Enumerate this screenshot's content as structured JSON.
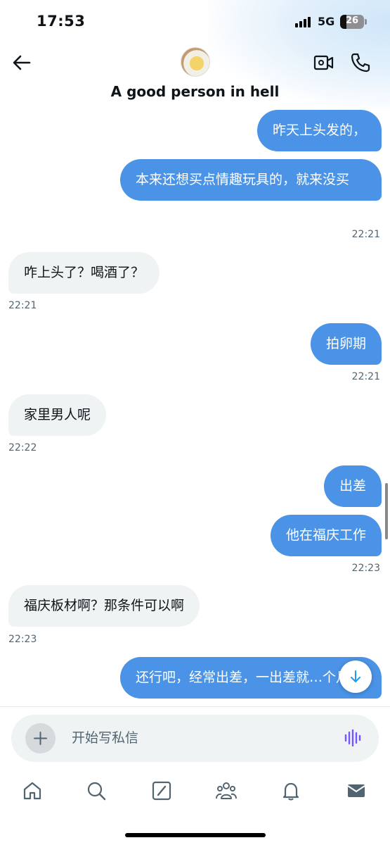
{
  "status_bar": {
    "time": "17:53",
    "network": "5G",
    "battery": "26"
  },
  "header": {
    "title": "A good person in hell"
  },
  "messages": [
    {
      "side": "out",
      "text": "昨天上头发的，"
    },
    {
      "side": "out",
      "text": "本来还想买点情趣玩具的，就来没买",
      "time": "22:21"
    },
    {
      "side": "in",
      "text": "咋上头了？喝酒了？",
      "time": "22:21"
    },
    {
      "side": "out",
      "text": "拍卵期",
      "time": "22:21"
    },
    {
      "side": "in",
      "text": "家里男人呢",
      "time": "22:22"
    },
    {
      "side": "out",
      "text": "出差"
    },
    {
      "side": "out",
      "text": "他在福庆工作",
      "time": "22:23"
    },
    {
      "side": "in",
      "text": "福庆板材啊？那条件可以啊",
      "time": "22:23"
    },
    {
      "side": "out",
      "text": "还行吧，经常出差，一出差就…个月"
    }
  ],
  "composer": {
    "placeholder": "开始写私信"
  },
  "nav": {
    "items": [
      "home-icon",
      "search-icon",
      "grok-icon",
      "communities-icon",
      "notifications-icon",
      "messages-icon"
    ]
  },
  "colors": {
    "outgoing_bubble": "#4a93e6",
    "incoming_bubble": "#eff3f4",
    "voice_icon": "#7856ff"
  }
}
